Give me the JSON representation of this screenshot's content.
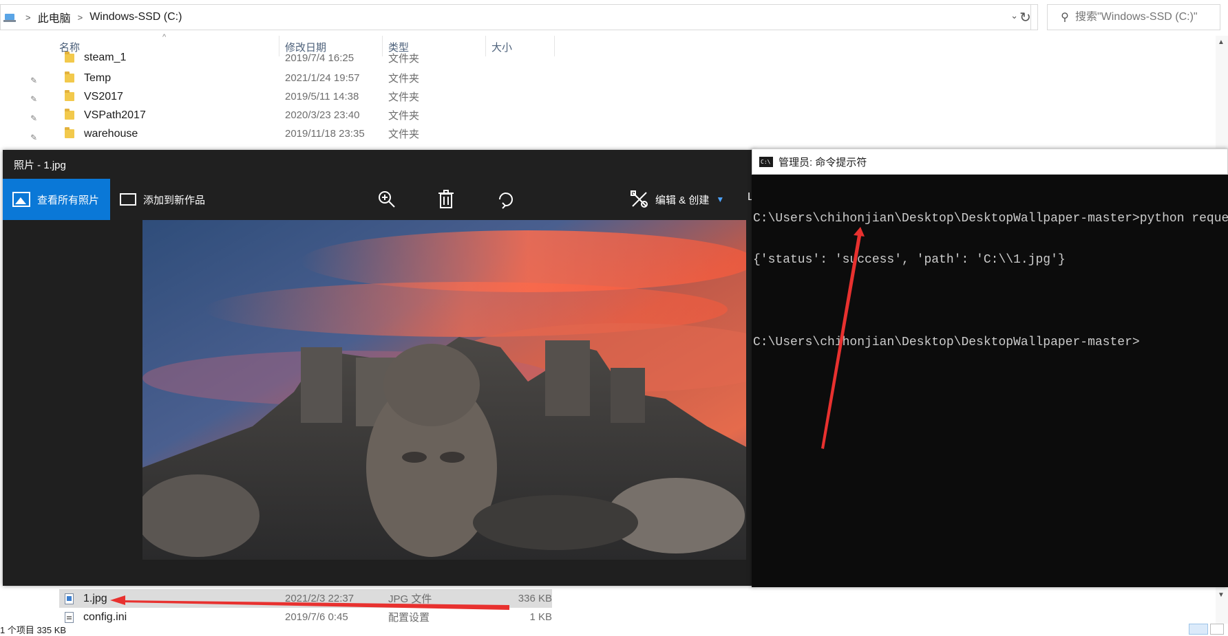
{
  "explorer": {
    "breadcrumb": [
      "此电脑",
      "Windows-SSD (C:)"
    ],
    "search_placeholder": "搜索\"Windows-SSD (C:)\"",
    "columns": [
      "名称",
      "修改日期",
      "类型",
      "大小"
    ],
    "files_top": [
      {
        "name": "steam_1",
        "date": "2019/7/4 16:25",
        "type": "文件夹",
        "size": ""
      },
      {
        "name": "Temp",
        "date": "2021/1/24 19:57",
        "type": "文件夹",
        "size": ""
      },
      {
        "name": "VS2017",
        "date": "2019/5/11 14:38",
        "type": "文件夹",
        "size": ""
      },
      {
        "name": "VSPath2017",
        "date": "2020/3/23 23:40",
        "type": "文件夹",
        "size": ""
      },
      {
        "name": "warehouse",
        "date": "2019/11/18 23:35",
        "type": "文件夹",
        "size": ""
      }
    ],
    "files_bottom": [
      {
        "name": "1.jpg",
        "date": "2021/2/3 22:37",
        "type": "JPG 文件",
        "size": "336 KB"
      },
      {
        "name": "config.ini",
        "date": "2019/7/6 0:45",
        "type": "配置设置",
        "size": "1 KB"
      }
    ],
    "status": "1 个项目  335 KB"
  },
  "photos": {
    "title": "照片 - 1.jpg",
    "view_all_label": "查看所有照片",
    "add_label": "添加到新作品",
    "edit_label": "编辑 & 创建",
    "more_label": "L"
  },
  "cmd": {
    "title": "管理员: 命令提示符",
    "lines": [
      "C:\\Users\\chihonjian\\Desktop\\DesktopWallpaper-master>python requestsIm",
      "{'status': 'success', 'path': 'C:\\\\1.jpg'}",
      "",
      "C:\\Users\\chihonjian\\Desktop\\DesktopWallpaper-master>"
    ]
  },
  "colors": {
    "accent": "#0a78d7",
    "annotation_arrow": "#e8312f",
    "cmd_bg": "#0c0c0c",
    "folder": "#f2c94c"
  }
}
